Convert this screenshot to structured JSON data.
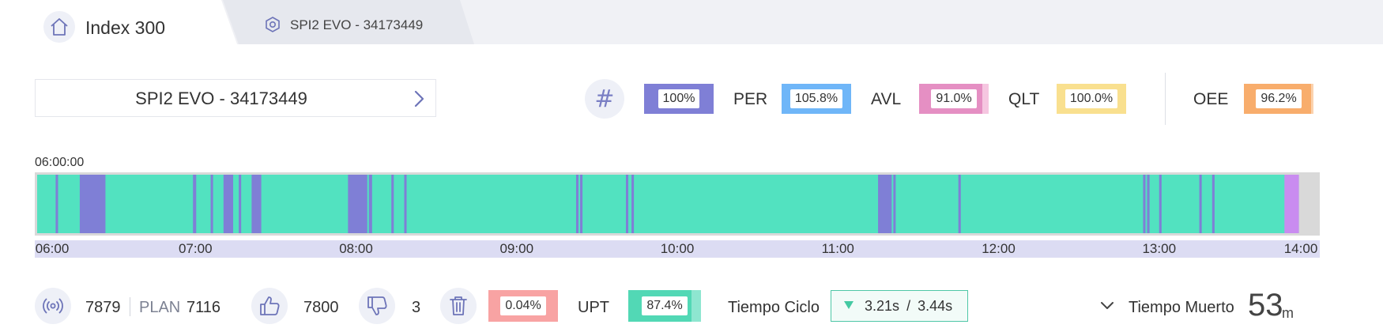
{
  "tabs": [
    {
      "label": "Index 300",
      "icon": "home-icon",
      "active": true
    },
    {
      "label": "SPI2 EVO - 34173449",
      "icon": "hexagon-icon",
      "active": false
    }
  ],
  "machine_selector": {
    "name": "SPI2 EVO - 34173449",
    "icon": "chevron-right-icon"
  },
  "metrics": {
    "hash_icon": "hash-icon",
    "first": {
      "value": "100%",
      "color": "#7f7fd6"
    },
    "per": {
      "label": "PER",
      "value": "105.8%",
      "color": "#6fb6f8"
    },
    "avl": {
      "label": "AVL",
      "value": "91.0%",
      "color": "#e58fc3",
      "fill": 0.91
    },
    "qlt": {
      "label": "QLT",
      "value": "100.0%",
      "color": "#f9e08f"
    },
    "oee": {
      "label": "OEE",
      "value": "96.2%",
      "color": "#f8ad6c",
      "fill": 0.962
    }
  },
  "timeline": {
    "start_time": "06:00:00",
    "axis_labels": [
      "06:00",
      "07:00",
      "08:00",
      "09:00",
      "10:00",
      "11:00",
      "12:00",
      "13:00",
      "14:00"
    ],
    "colors": {
      "running": "#52e2c0",
      "stop": "#7f7fd6",
      "alert": "#c98cf0",
      "no_data": "#d9d9d9"
    },
    "range_hours": [
      6,
      14
    ],
    "end_of_data_hour": 13.87,
    "events": [
      {
        "start": 6.13,
        "end": 6.145,
        "type": "stop"
      },
      {
        "start": 6.28,
        "end": 6.44,
        "type": "stop"
      },
      {
        "start": 6.985,
        "end": 7.005,
        "type": "stop"
      },
      {
        "start": 7.095,
        "end": 7.11,
        "type": "stop"
      },
      {
        "start": 7.175,
        "end": 7.235,
        "type": "stop"
      },
      {
        "start": 7.27,
        "end": 7.285,
        "type": "stop"
      },
      {
        "start": 7.35,
        "end": 7.41,
        "type": "stop"
      },
      {
        "start": 7.95,
        "end": 8.07,
        "type": "stop"
      },
      {
        "start": 8.08,
        "end": 8.1,
        "type": "stop"
      },
      {
        "start": 8.22,
        "end": 8.235,
        "type": "stop"
      },
      {
        "start": 8.3,
        "end": 8.315,
        "type": "stop"
      },
      {
        "start": 9.37,
        "end": 9.385,
        "type": "stop"
      },
      {
        "start": 9.395,
        "end": 9.41,
        "type": "stop"
      },
      {
        "start": 9.68,
        "end": 9.695,
        "type": "stop"
      },
      {
        "start": 9.715,
        "end": 9.73,
        "type": "stop"
      },
      {
        "start": 11.25,
        "end": 11.335,
        "type": "stop"
      },
      {
        "start": 11.345,
        "end": 11.355,
        "type": "stop"
      },
      {
        "start": 11.75,
        "end": 11.765,
        "type": "stop"
      },
      {
        "start": 12.9,
        "end": 12.915,
        "type": "stop"
      },
      {
        "start": 12.925,
        "end": 12.94,
        "type": "stop"
      },
      {
        "start": 13.0,
        "end": 13.015,
        "type": "stop"
      },
      {
        "start": 13.25,
        "end": 13.265,
        "type": "stop"
      },
      {
        "start": 13.33,
        "end": 13.345,
        "type": "stop"
      },
      {
        "start": 13.78,
        "end": 13.87,
        "type": "alert"
      }
    ]
  },
  "stats": {
    "signal_icon": "signal-icon",
    "produced": "7879",
    "plan_label": "PLAN",
    "plan_value": "7116",
    "thumbs_up_icon": "thumbs-up-icon",
    "good": "7800",
    "thumbs_down_icon": "thumbs-down-icon",
    "bad": "3",
    "trash_icon": "trash-icon",
    "scrap_rate": {
      "value": "0.04%",
      "color": "#f8a3a3"
    },
    "upt": {
      "label": "UPT",
      "value": "87.4%",
      "color": "#52d8b5",
      "fill": 0.874
    },
    "tiempo_ciclo": {
      "label": "Tiempo Ciclo",
      "actual": "3.21s",
      "separator": "/",
      "target": "3.44s"
    },
    "tiempo_muerto": {
      "label": "Tiempo Muerto",
      "value": "53",
      "unit": "m"
    }
  }
}
